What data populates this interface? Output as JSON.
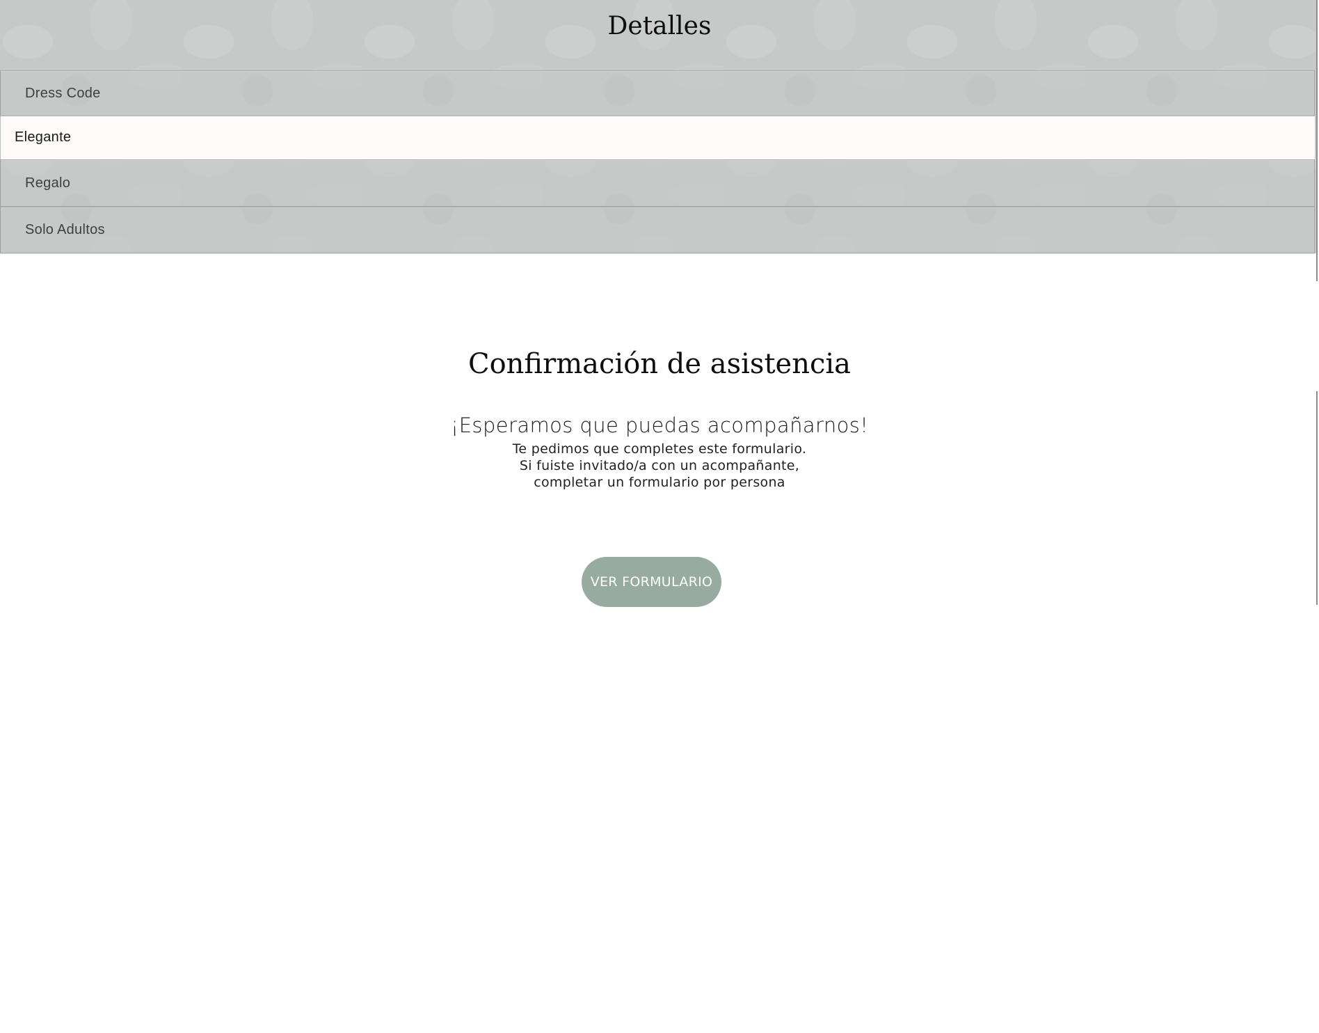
{
  "details": {
    "title": "Detalles",
    "items": [
      {
        "label": "Dress Code",
        "expanded": true,
        "content": "Elegante"
      },
      {
        "label": "Regalo",
        "expanded": false
      },
      {
        "label": "Solo Adultos",
        "expanded": false
      }
    ]
  },
  "rsvp": {
    "title": "Confirmación de asistencia",
    "subtitle": "¡Esperamos que puedas acompañarnos!",
    "lines": [
      "Te pedimos que completes este formulario.",
      "Si fuiste invitado/a con un acompañante,",
      "completar un formulario por persona"
    ],
    "button_label": "VER FORMULARIO"
  },
  "colors": {
    "section_background": "#c5c9c7",
    "expanded_panel": "#fefaf9",
    "button_background": "#98aba0",
    "button_text": "#ffffff"
  }
}
